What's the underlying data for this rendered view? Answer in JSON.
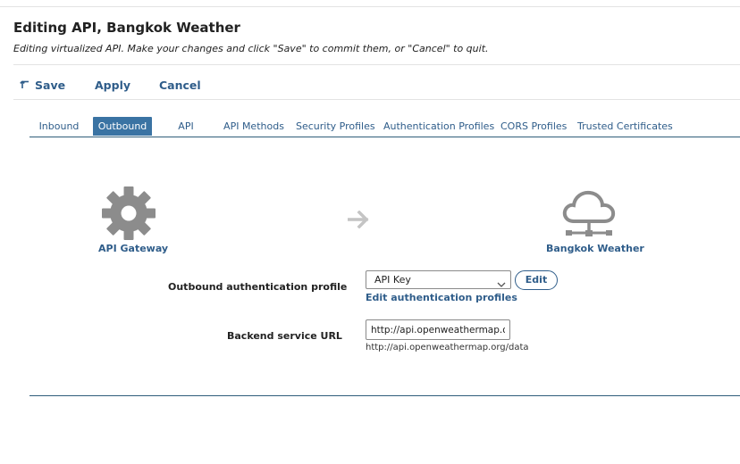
{
  "header": {
    "title": "Editing API, Bangkok Weather",
    "subtitle": "Editing virtualized API. Make your changes and click \"Save\" to commit them, or \"Cancel\" to quit."
  },
  "toolbar": {
    "save_label": "Save",
    "apply_label": "Apply",
    "cancel_label": "Cancel"
  },
  "tabs": [
    {
      "label": "Inbound"
    },
    {
      "label": "Outbound"
    },
    {
      "label": "API"
    },
    {
      "label": "API Methods"
    },
    {
      "label": "Security Profiles"
    },
    {
      "label": "Authentication Profiles"
    },
    {
      "label": "CORS Profiles"
    },
    {
      "label": "Trusted Certificates"
    }
  ],
  "active_tab": "Outbound",
  "diagram": {
    "source_label": "API Gateway",
    "source_icon": "gear-icon",
    "arrow_icon": "arrow-right-icon",
    "target_label": "Bangkok Weather",
    "target_icon": "cloud-network-icon"
  },
  "form": {
    "auth_profile_label": "Outbound authentication profile",
    "auth_profile_value": "API Key",
    "edit_button": "Edit",
    "edit_profiles_link": "Edit authentication profiles",
    "backend_url_label": "Backend service URL",
    "backend_url_value": "http://api.openweathermap.org/data",
    "backend_url_hint": "http://api.openweathermap.org/data"
  },
  "colors": {
    "accent": "#2f5d8a",
    "active_tab_bg": "#3a73a3",
    "icon_gray": "#8c8c8c"
  }
}
